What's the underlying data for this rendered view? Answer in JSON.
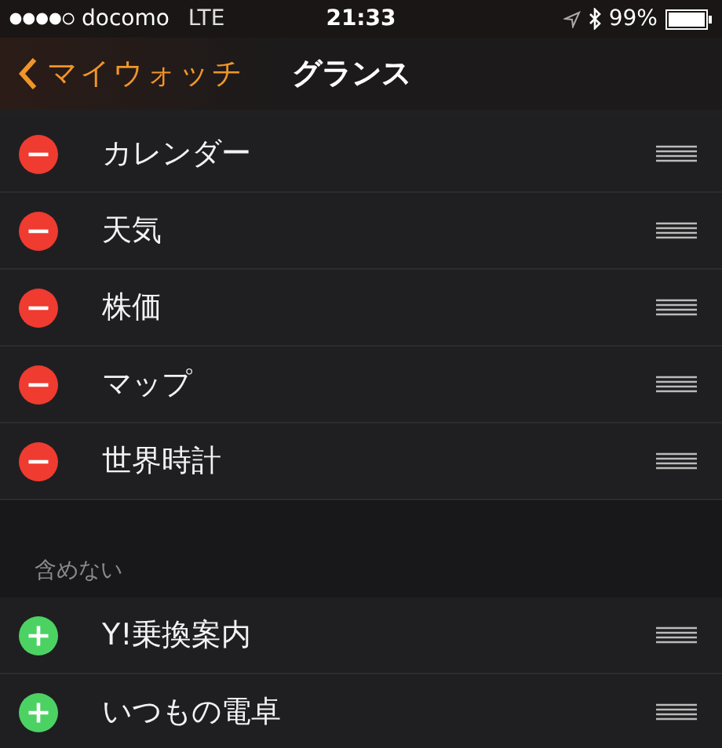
{
  "status_bar": {
    "carrier": "docomo",
    "network": "LTE",
    "time": "21:33",
    "battery": "99%"
  },
  "nav": {
    "back": "マイウォッチ",
    "title": "グランス"
  },
  "sections": [
    {
      "rows": [
        {
          "label": "カレンダー",
          "kind": "remove"
        },
        {
          "label": "天気",
          "kind": "remove"
        },
        {
          "label": "株価",
          "kind": "remove"
        },
        {
          "label": "マップ",
          "kind": "remove"
        },
        {
          "label": "世界時計",
          "kind": "remove"
        }
      ]
    },
    {
      "header": "含めない",
      "rows": [
        {
          "label": "Y!乗換案内",
          "kind": "add"
        },
        {
          "label": "いつもの電卓",
          "kind": "add"
        }
      ]
    }
  ]
}
